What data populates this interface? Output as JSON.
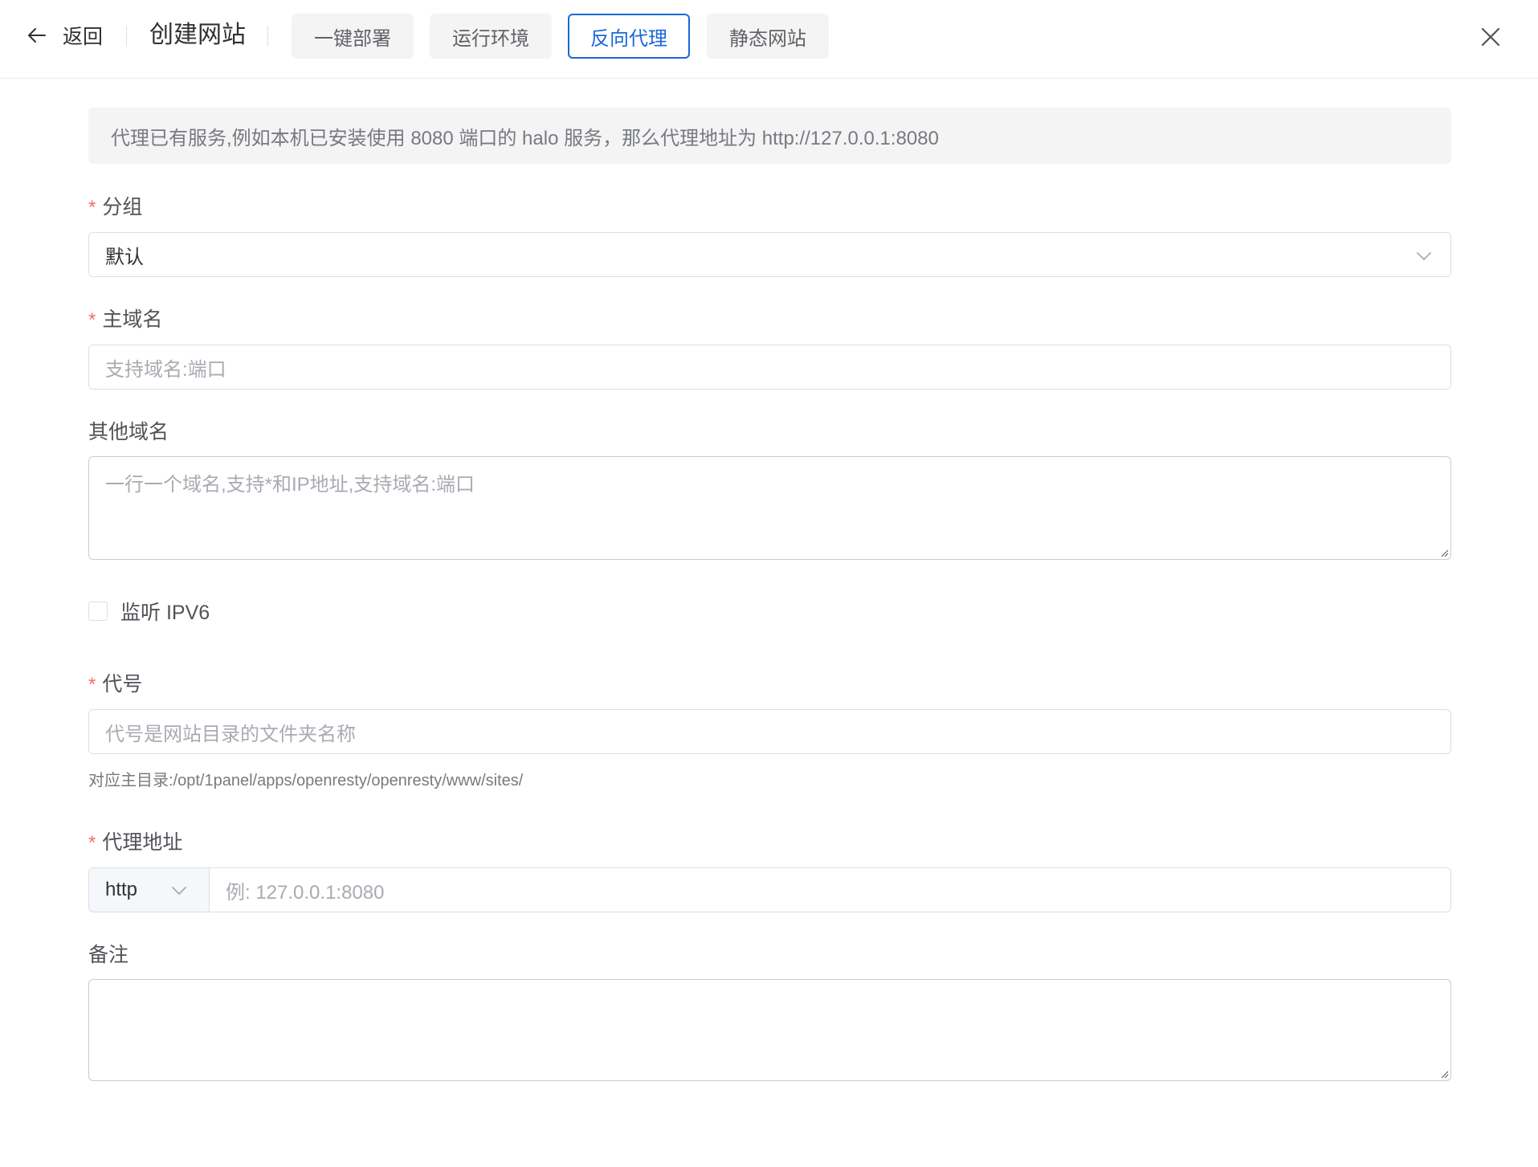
{
  "header": {
    "back_label": "返回",
    "title": "创建网站",
    "tabs": [
      {
        "label": "一键部署",
        "active": false
      },
      {
        "label": "运行环境",
        "active": false
      },
      {
        "label": "反向代理",
        "active": true
      },
      {
        "label": "静态网站",
        "active": false
      }
    ]
  },
  "alert": {
    "text": "代理已有服务,例如本机已安装使用 8080 端口的 halo 服务，那么代理地址为 http://127.0.0.1:8080"
  },
  "form": {
    "group": {
      "label": "分组",
      "required": true,
      "value": "默认"
    },
    "primary_domain": {
      "label": "主域名",
      "required": true,
      "placeholder": "支持域名:端口"
    },
    "other_domains": {
      "label": "其他域名",
      "required": false,
      "placeholder": "一行一个域名,支持*和IP地址,支持域名:端口"
    },
    "ipv6": {
      "label": "监听 IPV6",
      "checked": false
    },
    "alias": {
      "label": "代号",
      "required": true,
      "placeholder": "代号是网站目录的文件夹名称",
      "hint": "对应主目录:/opt/1panel/apps/openresty/openresty/www/sites/"
    },
    "proxy": {
      "label": "代理地址",
      "required": true,
      "protocol": "http",
      "placeholder": "例: 127.0.0.1:8080"
    },
    "remark": {
      "label": "备注",
      "required": false,
      "value": ""
    }
  },
  "icons": {
    "back": "arrow-left-icon",
    "close": "close-icon",
    "select": "chevron-down-icon"
  },
  "colors": {
    "accent": "#1a68d8",
    "required": "#f56c6c"
  }
}
